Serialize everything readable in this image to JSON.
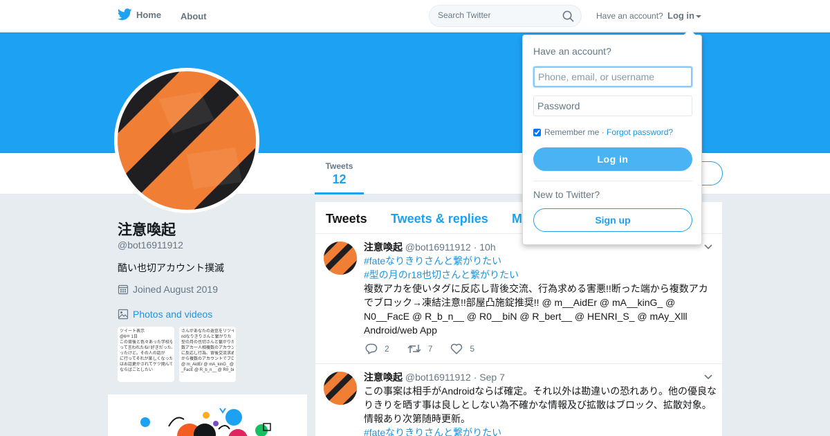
{
  "nav": {
    "home_label": "Home",
    "about_label": "About",
    "search_placeholder": "Search Twitter",
    "have_account": "Have an account?",
    "login_label": "Log in"
  },
  "colors": {
    "brand": "#1da1f2",
    "banner": "#1da1f2",
    "avatar_stripe_orange": "#f07f35",
    "avatar_stripe_black": "#1f1f22"
  },
  "profile": {
    "name": "注意喚起",
    "handle": "@bot16911912",
    "bio": "酷い也切アカウント撲滅",
    "joined": "Joined August 2019",
    "photos_link": "Photos and videos"
  },
  "stats": {
    "tweets_label": "Tweets",
    "tweets_value": "12"
  },
  "timeline": {
    "tabs": [
      {
        "label": "Tweets"
      },
      {
        "label": "Tweets & replies"
      },
      {
        "label": "M"
      }
    ],
    "tweets": [
      {
        "name": "注意喚起",
        "handle": "@bot16911912",
        "time": "· 10h",
        "tags": [
          "#fateなりきりさんと繋がりたい",
          "#型の月のr18也切さんと繋がりたい"
        ],
        "text": "複数アカを使いタグに反応し背後交流、行為求める害悪!!断った端から複数アカでブロック→凍結注意!!部屋凸施錠推奨!! @ m__AidEr @ mA__kinG_ @ N0__FacE @ R_b_n__ @ R0__biN @ R_bert__ @ HENRI_S_ @ mAy_Xlll Android/web App",
        "replies": "2",
        "retweets": "7",
        "likes": "5"
      },
      {
        "name": "注意喚起",
        "handle": "@bot16911912",
        "time": "· Sep 7",
        "text": "この事案は相手がAndroidならば確定。それ以外は勘違いの恐れあり。他の優良なりきりを晒す事は良しとしない為不確かな情報及び拡散はブロック、拡散対象。情報あり次第随時更新。",
        "tag": "#fateなりきりさんと繋がりたい"
      }
    ]
  },
  "login_dropdown": {
    "title": "Have an account?",
    "username_placeholder": "Phone, email, or username",
    "password_placeholder": "Password",
    "remember_me": "Remember me",
    "separator": " · ",
    "forgot_password": "Forgot password?",
    "login_button": "Log in",
    "new_to_twitter": "New to Twitter?",
    "signup_button": "Sign up"
  },
  "thumbnails": [
    {
      "lines": [
        "ツイート表示",
        "@6ㅁ 1日",
        "この背後と色々あった学校なり",
        "って言われたね! 好きだったんだ",
        "ったけど。その人の話が",
        "に行ってそれが楽しくなったのが",
        "はお話更かされてケツ開んで",
        "ならばごとしたい"
      ]
    },
    {
      "lines": [
        "さんがあなたの返信をリツイー",
        "ndなりきりさんと繋がりた",
        "型の月の也切さんと繋がりたい",
        "数アカ一人相複数のアカウントを",
        "に反応し行為、背後交流求める害",
        "から複数のアカウントでブロッ",
        "@ m_AidEr @ mA_kinG_ @",
        "_FacE @ R_b_n__ @ R0_biN"
      ]
    }
  ]
}
